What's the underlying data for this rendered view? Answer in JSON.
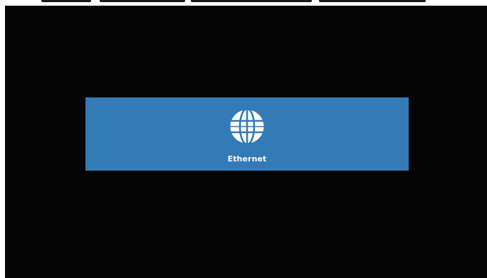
{
  "screen": {
    "background_color": "#050505"
  },
  "network_option": {
    "label": "Ethernet",
    "icon": "globe-icon",
    "tile_color": "#337ab7"
  }
}
